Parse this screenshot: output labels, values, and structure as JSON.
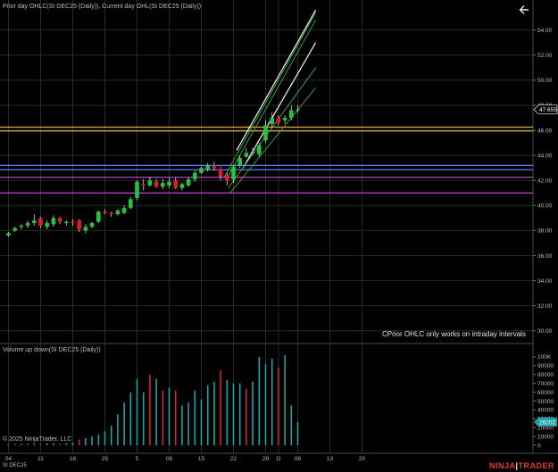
{
  "titles": {
    "price": "Prior day OHLC(SI DEC25 (Daily)), Current day OHL(SI DEC25 (Daily))",
    "volume": "Volume up down(SI DEC25 (Daily))"
  },
  "copyright": "© 2025 NinjaTrader, LLC",
  "symbol": "SI DEC25",
  "overlay_message": "CPrior OHLC only works on intraday intervals",
  "logo": {
    "left": "NINJA",
    "pipe": "|",
    "right": "TRADER"
  },
  "back_icon": "arrow-left-icon",
  "colors": {
    "up": "#22c53b",
    "down": "#e3172f",
    "background": "#000000",
    "vol_up": "#1fa3a3",
    "vol_down": "#d4203a",
    "orange": "#e8a63a",
    "blue": "#5e7df0",
    "purple": "#c84fd8",
    "magenta": "#d23ad6",
    "channel_outer": "#3cae4a",
    "channel_inner": "#e8e8e8",
    "grid": "#2a2a2a"
  },
  "price_axis": {
    "ticks": [
      30,
      32,
      34,
      36,
      38,
      40,
      42,
      44,
      46,
      48,
      50,
      52,
      54
    ],
    "range": [
      29.2,
      55.4
    ],
    "last_price_label": "47.655",
    "last_price": 47.655
  },
  "volume_axis": {
    "ticks": [
      0,
      10000,
      20000,
      30000,
      40000,
      50000,
      60000,
      70000,
      80000,
      90000,
      100000
    ],
    "tick_labels": [
      "0",
      "10000",
      "20000",
      "30000",
      "40000",
      "50000",
      "60000",
      "70000",
      "80000",
      "90000",
      "100K"
    ],
    "range": [
      -2000,
      108000
    ],
    "last_volume_label": "26202",
    "last_volume": 26202
  },
  "date_axis": {
    "labels": [
      "04",
      "11",
      "18",
      "25",
      "5",
      "08",
      "15",
      "22",
      "29",
      "O",
      "06",
      "13",
      "20"
    ],
    "label_bar_index": [
      0,
      5,
      10,
      15,
      20,
      25,
      30,
      35,
      40,
      42,
      45,
      50,
      55
    ]
  },
  "horizontal_levels": [
    {
      "value": 46.25,
      "color": "orange"
    },
    {
      "value": 45.95,
      "color": "orange"
    },
    {
      "value": 43.2,
      "color": "blue"
    },
    {
      "value": 42.85,
      "color": "blue"
    },
    {
      "value": 42.25,
      "color": "purple"
    },
    {
      "value": 41.0,
      "color": "magenta"
    }
  ],
  "chart_data": {
    "type": "candlestick",
    "symbol": "SI DEC25",
    "candles": [
      {
        "o": 37.6,
        "h": 37.9,
        "l": 37.5,
        "c": 37.8
      },
      {
        "o": 38.0,
        "h": 38.3,
        "l": 37.9,
        "c": 38.2
      },
      {
        "o": 38.3,
        "h": 38.5,
        "l": 38.1,
        "c": 38.4
      },
      {
        "o": 38.4,
        "h": 38.8,
        "l": 38.2,
        "c": 38.6
      },
      {
        "o": 38.6,
        "h": 39.3,
        "l": 38.4,
        "c": 38.8
      },
      {
        "o": 39.0,
        "h": 39.1,
        "l": 38.2,
        "c": 38.4
      },
      {
        "o": 38.3,
        "h": 38.8,
        "l": 38.1,
        "c": 38.6
      },
      {
        "o": 38.5,
        "h": 39.2,
        "l": 38.3,
        "c": 39.0
      },
      {
        "o": 39.0,
        "h": 39.1,
        "l": 38.5,
        "c": 38.7
      },
      {
        "o": 38.6,
        "h": 38.8,
        "l": 38.4,
        "c": 38.7
      },
      {
        "o": 38.7,
        "h": 38.9,
        "l": 38.4,
        "c": 38.6
      },
      {
        "o": 38.8,
        "h": 38.9,
        "l": 37.9,
        "c": 38.1
      },
      {
        "o": 38.0,
        "h": 38.5,
        "l": 37.8,
        "c": 38.3
      },
      {
        "o": 38.3,
        "h": 38.7,
        "l": 38.2,
        "c": 38.6
      },
      {
        "o": 38.7,
        "h": 39.6,
        "l": 38.6,
        "c": 39.5
      },
      {
        "o": 39.5,
        "h": 39.7,
        "l": 39.3,
        "c": 39.4
      },
      {
        "o": 39.4,
        "h": 39.5,
        "l": 39.1,
        "c": 39.3
      },
      {
        "o": 39.3,
        "h": 39.7,
        "l": 39.2,
        "c": 39.6
      },
      {
        "o": 39.4,
        "h": 40.0,
        "l": 39.3,
        "c": 39.8
      },
      {
        "o": 39.8,
        "h": 40.7,
        "l": 39.7,
        "c": 40.5
      },
      {
        "o": 40.6,
        "h": 42.0,
        "l": 40.4,
        "c": 41.9
      },
      {
        "o": 41.7,
        "h": 42.1,
        "l": 41.2,
        "c": 41.6
      },
      {
        "o": 41.6,
        "h": 42.3,
        "l": 41.5,
        "c": 42.0
      },
      {
        "o": 41.9,
        "h": 42.1,
        "l": 41.4,
        "c": 41.5
      },
      {
        "o": 41.5,
        "h": 42.1,
        "l": 41.3,
        "c": 41.8
      },
      {
        "o": 41.6,
        "h": 42.2,
        "l": 41.4,
        "c": 41.9
      },
      {
        "o": 42.0,
        "h": 42.2,
        "l": 41.3,
        "c": 41.4
      },
      {
        "o": 41.4,
        "h": 41.8,
        "l": 41.2,
        "c": 41.7
      },
      {
        "o": 41.6,
        "h": 42.2,
        "l": 41.5,
        "c": 42.1
      },
      {
        "o": 42.1,
        "h": 42.8,
        "l": 41.9,
        "c": 42.6
      },
      {
        "o": 42.6,
        "h": 43.1,
        "l": 42.5,
        "c": 43.0
      },
      {
        "o": 42.9,
        "h": 43.4,
        "l": 42.7,
        "c": 43.2
      },
      {
        "o": 43.2,
        "h": 43.5,
        "l": 42.8,
        "c": 43.0
      },
      {
        "o": 42.9,
        "h": 43.1,
        "l": 42.0,
        "c": 42.3
      },
      {
        "o": 42.4,
        "h": 42.6,
        "l": 41.6,
        "c": 42.0
      },
      {
        "o": 42.1,
        "h": 43.2,
        "l": 41.8,
        "c": 43.1
      },
      {
        "o": 43.2,
        "h": 44.0,
        "l": 43.0,
        "c": 43.8
      },
      {
        "o": 43.9,
        "h": 44.6,
        "l": 43.8,
        "c": 44.2
      },
      {
        "o": 44.3,
        "h": 44.6,
        "l": 44.1,
        "c": 44.3
      },
      {
        "o": 44.1,
        "h": 45.0,
        "l": 43.9,
        "c": 44.8
      },
      {
        "o": 45.2,
        "h": 46.8,
        "l": 45.0,
        "c": 46.4
      },
      {
        "o": 46.5,
        "h": 47.4,
        "l": 46.2,
        "c": 47.0
      },
      {
        "o": 47.0,
        "h": 47.2,
        "l": 46.4,
        "c": 46.6
      },
      {
        "o": 46.8,
        "h": 47.2,
        "l": 46.5,
        "c": 47.0
      },
      {
        "o": 47.0,
        "h": 48.0,
        "l": 46.8,
        "c": 47.6
      },
      {
        "o": 47.6,
        "h": 48.0,
        "l": 47.4,
        "c": 47.655
      }
    ],
    "volume": [
      {
        "v": 1000,
        "up": true
      },
      {
        "v": 1200,
        "up": true
      },
      {
        "v": 1500,
        "up": true
      },
      {
        "v": 1300,
        "up": true
      },
      {
        "v": 1800,
        "up": true
      },
      {
        "v": 1600,
        "up": false
      },
      {
        "v": 2000,
        "up": true
      },
      {
        "v": 2200,
        "up": true
      },
      {
        "v": 1900,
        "up": false
      },
      {
        "v": 2400,
        "up": true
      },
      {
        "v": 3000,
        "up": true
      },
      {
        "v": 6500,
        "up": false
      },
      {
        "v": 8000,
        "up": true
      },
      {
        "v": 10000,
        "up": true
      },
      {
        "v": 12000,
        "up": true
      },
      {
        "v": 16000,
        "up": true
      },
      {
        "v": 22000,
        "up": true
      },
      {
        "v": 35000,
        "up": true
      },
      {
        "v": 48000,
        "up": true
      },
      {
        "v": 60000,
        "up": true
      },
      {
        "v": 75000,
        "up": true
      },
      {
        "v": 60000,
        "up": true
      },
      {
        "v": 80000,
        "up": false
      },
      {
        "v": 75000,
        "up": true
      },
      {
        "v": 62000,
        "up": false
      },
      {
        "v": 65000,
        "up": true
      },
      {
        "v": 62000,
        "up": false
      },
      {
        "v": 45000,
        "up": true
      },
      {
        "v": 48000,
        "up": true
      },
      {
        "v": 62000,
        "up": true
      },
      {
        "v": 52000,
        "up": true
      },
      {
        "v": 68000,
        "up": true
      },
      {
        "v": 72000,
        "up": true
      },
      {
        "v": 85000,
        "up": false
      },
      {
        "v": 74000,
        "up": true
      },
      {
        "v": 70000,
        "up": true
      },
      {
        "v": 70000,
        "up": true
      },
      {
        "v": 64000,
        "up": false
      },
      {
        "v": 72000,
        "up": true
      },
      {
        "v": 100000,
        "up": true
      },
      {
        "v": 92000,
        "up": true
      },
      {
        "v": 98000,
        "up": true
      },
      {
        "v": 88000,
        "up": false
      },
      {
        "v": 102000,
        "up": true
      },
      {
        "v": 45000,
        "up": true
      },
      {
        "v": 26202,
        "up": true
      }
    ],
    "channels": [
      {
        "name": "inner_upper",
        "x0": 35.5,
        "y0": 44.4,
        "x1": 47.8,
        "y1": 55.6,
        "color": "channel_inner"
      },
      {
        "name": "inner_lower",
        "x0": 36.5,
        "y0": 43.0,
        "x1": 47.8,
        "y1": 53.0,
        "color": "channel_inner"
      },
      {
        "name": "outer_upper",
        "x0": 33.5,
        "y0": 42.2,
        "x1": 47.8,
        "y1": 55.4,
        "color": "channel_outer"
      },
      {
        "name": "outer_mid",
        "x0": 33.8,
        "y0": 42.0,
        "x1": 47.8,
        "y1": 54.8,
        "color": "channel_outer"
      },
      {
        "name": "outer_lower",
        "x0": 34.2,
        "y0": 41.4,
        "x1": 47.8,
        "y1": 51.0,
        "color": "channel_outer"
      },
      {
        "name": "outer_lowest",
        "x0": 34.5,
        "y0": 41.0,
        "x1": 47.8,
        "y1": 49.4,
        "color": "channel_outer"
      }
    ]
  }
}
